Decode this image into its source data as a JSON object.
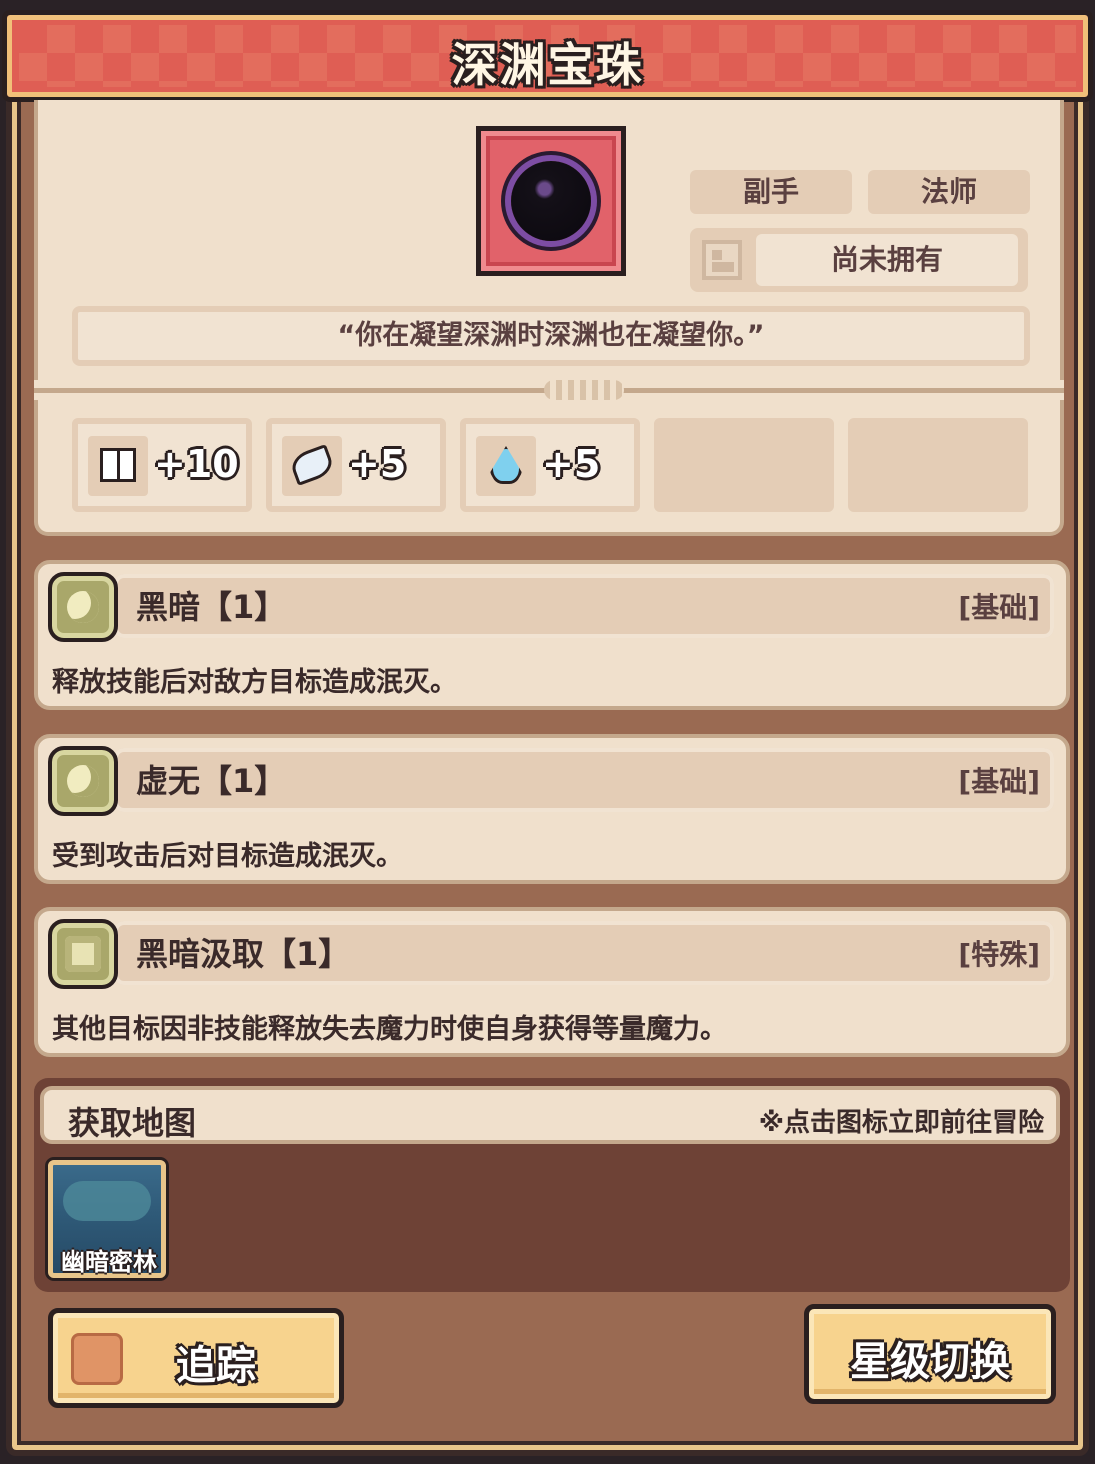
{
  "header": {
    "title": "深渊宝珠"
  },
  "item": {
    "icon": "dark-orb-icon",
    "tags": [
      "副手",
      "法师"
    ],
    "ownership_icon": "inventory-box-icon",
    "ownership": "尚未拥有",
    "quote": "“你在凝望深渊时深渊也在凝望你。”"
  },
  "stats": [
    {
      "icon": "book-icon",
      "value": "+10"
    },
    {
      "icon": "feather-icon",
      "value": "+5"
    },
    {
      "icon": "water-drop-icon",
      "value": "+5"
    }
  ],
  "traits": [
    {
      "icon": "moon-medal-icon",
      "name": "黑暗【1】",
      "kind": "[基础]",
      "desc": "释放技能后对敌方目标造成泯灭。"
    },
    {
      "icon": "moon-medal-icon",
      "name": "虚无【1】",
      "kind": "[基础]",
      "desc": "受到攻击后对目标造成泯灭。"
    },
    {
      "icon": "ring-medal-icon",
      "name": "黑暗汲取【1】",
      "kind": "[特殊]",
      "desc": "其他目标因非技能释放失去魔力时使自身获得等量魔力。"
    }
  ],
  "maps": {
    "label": "获取地图",
    "hint": "※点击图标立即前往冒险",
    "items": [
      {
        "name": "幽暗密林",
        "icon": "forest-map-icon"
      }
    ]
  },
  "buttons": {
    "track": "追踪",
    "track_icon": "thumbs-up-icon",
    "star_switch": "星级切换"
  },
  "colors": {
    "header": "#df5e54",
    "panel": "#f0e0cc",
    "frame": "#9a6a52",
    "button": "#f7d38e",
    "item_bg": "#e1626a"
  }
}
